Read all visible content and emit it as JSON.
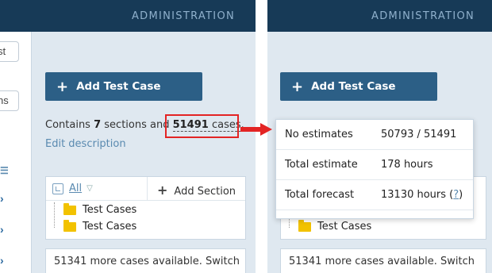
{
  "header": {
    "label": "ADMINISTRATION"
  },
  "strip": {
    "field_top": "st",
    "field_bottom": "ns",
    "icon_list": "☰",
    "chevrons": [
      "›",
      "›",
      "›"
    ]
  },
  "toolbar": {
    "add_test_case_label": "Add Test Case"
  },
  "summary": {
    "prefix": "Contains ",
    "sections_count": "7",
    "middle": " sections and ",
    "cases_count": "51491",
    "cases_label": " cases",
    "suffix": "."
  },
  "edit_description": "Edit description",
  "tree": {
    "filter_label": "All",
    "add_section_label": "Add Section",
    "nodes": [
      "Test Cases",
      "Test Cases"
    ]
  },
  "more_cases_text": "51341 more cases available. Switch",
  "estimates_popover": {
    "rows": [
      {
        "label": "No estimates",
        "value": "50793 / 51491"
      },
      {
        "label": "Total estimate",
        "value": "178 hours"
      },
      {
        "label": "Total forecast",
        "value": "13130 hours (",
        "help": "?",
        "value_end": ")"
      }
    ]
  },
  "colors": {
    "topbar": "#173a57",
    "button": "#2c5f86",
    "highlight": "#e32424",
    "folder": "#f2c200",
    "link": "#5a8ab0"
  }
}
